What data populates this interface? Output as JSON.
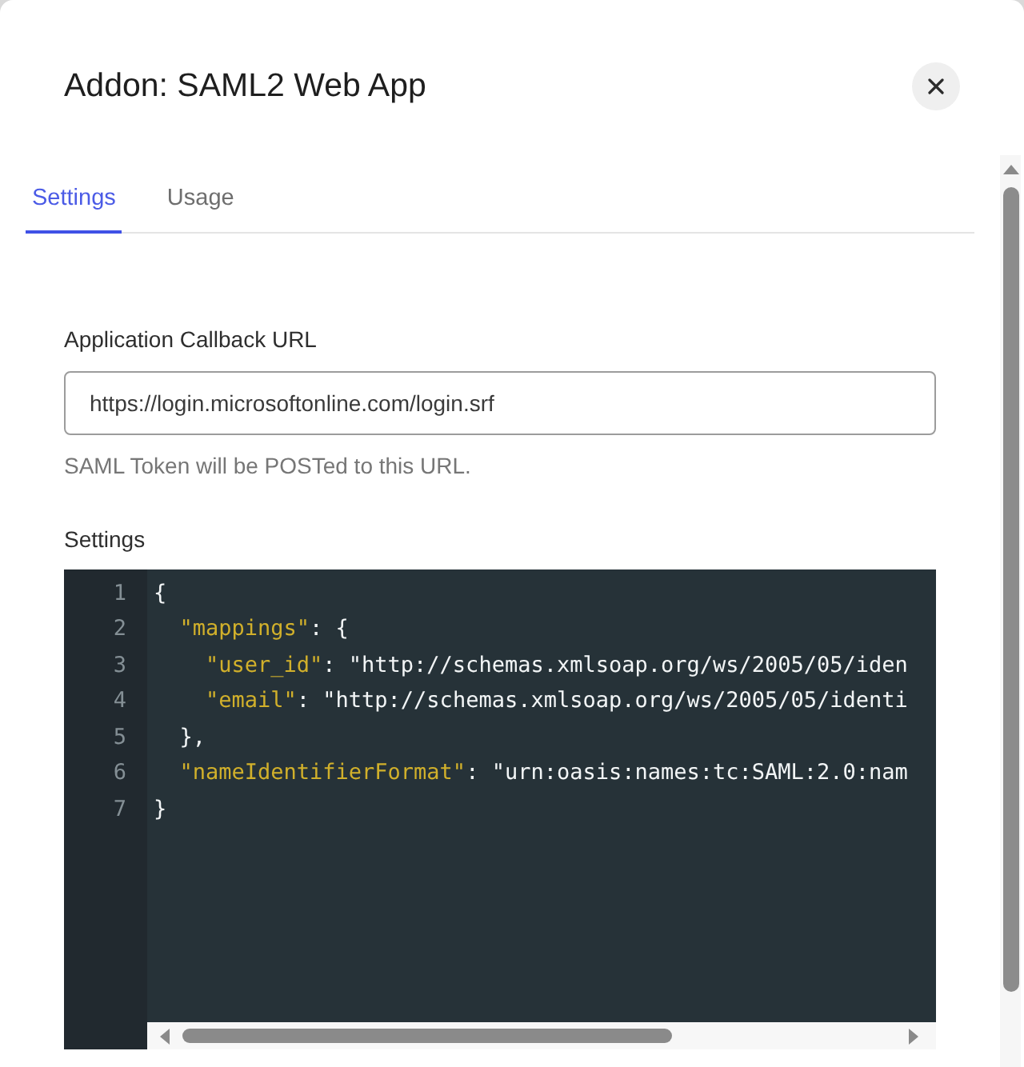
{
  "dialog": {
    "title": "Addon: SAML2 Web App"
  },
  "tabs": [
    {
      "label": "Settings",
      "selected": true
    },
    {
      "label": "Usage",
      "selected": false
    }
  ],
  "callback_url": {
    "label": "Application Callback URL",
    "value": "https://login.microsoftonline.com/login.srf",
    "help_text": "SAML Token will be POSTed to this URL."
  },
  "settings": {
    "label": "Settings",
    "editor": {
      "lines": [
        {
          "number": "1",
          "tokens": [
            {
              "kind": "plain",
              "text": "{"
            }
          ],
          "children": [
            {
              "number": "2",
              "tokens": [
                {
                  "kind": "key",
                  "text": "\"mappings\""
                },
                {
                  "kind": "plain",
                  "text": ": {"
                }
              ],
              "children": [
                {
                  "number": "3",
                  "tokens": [
                    {
                      "kind": "key",
                      "text": "\"user_id\""
                    },
                    {
                      "kind": "plain",
                      "text": ": \"http://schemas.xmlsoap.org/ws/2005/05/iden"
                    }
                  ]
                },
                {
                  "number": "4",
                  "tokens": [
                    {
                      "kind": "key",
                      "text": "\"email\""
                    },
                    {
                      "kind": "plain",
                      "text": ": \"http://schemas.xmlsoap.org/ws/2005/05/identi"
                    }
                  ]
                }
              ]
            },
            {
              "number": "5",
              "tokens": [
                {
                  "kind": "plain",
                  "text": "},"
                }
              ]
            },
            {
              "number": "6",
              "tokens": [
                {
                  "kind": "key",
                  "text": "\"nameIdentifierFormat\""
                },
                {
                  "kind": "plain",
                  "text": ": \"urn:oasis:names:tc:SAML:2.0:nam"
                }
              ]
            }
          ]
        },
        {
          "number": "7",
          "tokens": [
            {
              "kind": "plain",
              "text": "}"
            }
          ]
        }
      ]
    }
  }
}
